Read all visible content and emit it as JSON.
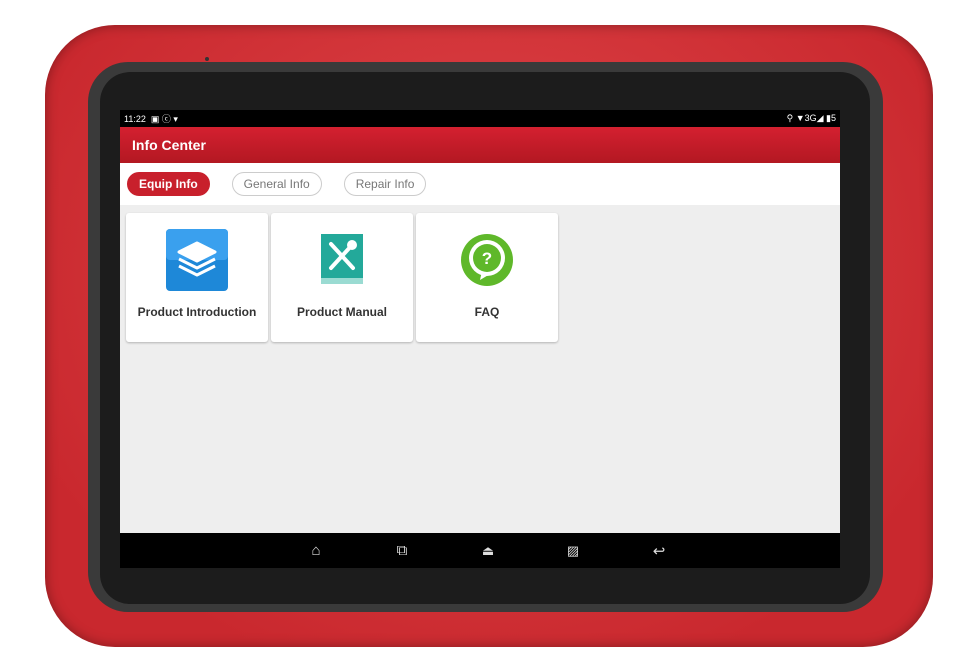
{
  "status_bar": {
    "time": "11:22",
    "left_icons": "▣ ⓒ ▾",
    "right_icons": "⚲ ▼3G◢ ▮5"
  },
  "header": {
    "title": "Info Center"
  },
  "tabs": [
    {
      "label": "Equip Info",
      "active": true
    },
    {
      "label": "General Info",
      "active": false
    },
    {
      "label": "Repair Info",
      "active": false
    }
  ],
  "cards": [
    {
      "label": "Product Introduction",
      "icon": "layers-icon"
    },
    {
      "label": "Product Manual",
      "icon": "manual-tools-icon"
    },
    {
      "label": "FAQ",
      "icon": "question-icon"
    }
  ],
  "nav": {
    "icons": [
      "home-icon",
      "recent-apps-icon",
      "vci-icon",
      "screenshot-icon",
      "back-icon"
    ]
  },
  "colors": {
    "accent": "#c8202c",
    "case": "#d63a3e"
  }
}
